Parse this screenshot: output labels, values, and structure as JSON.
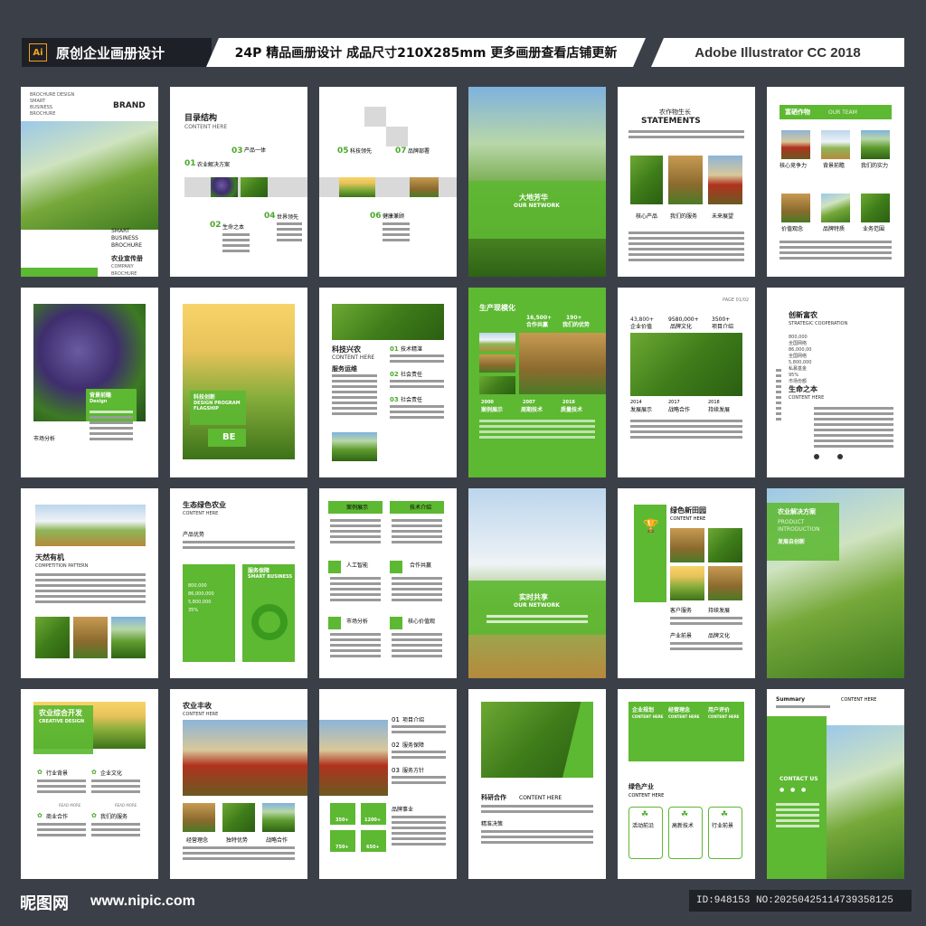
{
  "header": {
    "badge": "Ai",
    "left_title": "原创企业画册设计",
    "center_title": "24P 精品画册设计  成品尺寸210X285mm  更多画册查看店铺更新",
    "right_title": "Adobe Illustrator CC 2018"
  },
  "pages": {
    "p1": {
      "brand": "BRAND",
      "tiny1": "BROCHURE DESIGN",
      "tiny2": "SMART",
      "tiny3": "BUSINESS",
      "tiny4": "BROCHURE",
      "smart": "SMART",
      "business": "BUSINESS",
      "brochure": "BROCHURE",
      "title": "农业宣传册",
      "sub": "COMPANY BROCHURE"
    },
    "p2": {
      "title": "目录结构",
      "sub": "CONTENT HERE",
      "n1": "01",
      "l1": "农业解决方案",
      "n2": "03",
      "l2": "产品一体",
      "n3": "02",
      "l3": "生命之本",
      "n4": "04",
      "l4": "世界领先"
    },
    "p3": {
      "n1": "05",
      "l1": "科技领先",
      "n2": "07",
      "l2": "品牌部署",
      "n3": "06",
      "l3": "健康兼顾"
    },
    "p4": {
      "title": "大地芳华",
      "sub": "OUR NETWORK"
    },
    "p5": {
      "title": "农作物生长",
      "sub": "STATEMENTS",
      "c1": "核心产品",
      "c2": "我们的服务",
      "c3": "未来展望"
    },
    "p6": {
      "title": "富硒作物",
      "sub": "OUR TEAM",
      "c1": "核心竞争力",
      "c2": "背景前瞻",
      "c3": "我们的实力",
      "c4": "价值观念",
      "c5": "品牌特质",
      "c6": "业务范围"
    },
    "p7": {
      "title": "背景前瞻",
      "sub": "Design",
      "label": "市场分析"
    },
    "p8": {
      "title": "科技创新",
      "sub": "DESIGN PROGRAM",
      "sub2": "FLAGSHIP",
      "be": "BE"
    },
    "p9": {
      "title": "科技兴农",
      "sub": "CONTENT HERE",
      "s2": "服务运维",
      "n1": "01",
      "l1": "技术精湛",
      "n2": "02",
      "l2": "社会责任",
      "n3": "03",
      "l3": "社会责任"
    },
    "p10": {
      "title": "生产现模化",
      "v1": "16,500+",
      "l1": "合作共赢",
      "v2": "190+",
      "l2": "我们的优势",
      "y1": "2000",
      "y2": "2007",
      "y3": "2018",
      "c1": "案例展示",
      "c2": "周期技术",
      "c3": "质量技术"
    },
    "p11": {
      "page": "PAGE 01/02",
      "v1": "43,800+",
      "l1": "企业价值",
      "v2": "9580,000+",
      "l2": "品牌文化",
      "v3": "3500+",
      "l3": "项目介绍",
      "y1": "2014",
      "y2": "2017",
      "y3": "2018",
      "c1": "发展展示",
      "c2": "战略合作",
      "c3": "持续发展"
    },
    "p12": {
      "title": "创新富农",
      "sub": "STRATEGIC COOPERATION",
      "v1": "800,000",
      "l1": "全国网络",
      "v2": "86,000,00",
      "l2": "全国网络",
      "v3": "5,800,000",
      "l3": "私募基金",
      "v4": "95%",
      "l4": "市场份额",
      "t2": "生命之本",
      "sub2": "CONTENT HERE"
    },
    "p13": {
      "title": "天然有机",
      "sub": "COMPETITION PATTERN"
    },
    "p14": {
      "title": "生态绿色农业",
      "sub": "CONTENT HERE",
      "s2": "产品优势",
      "v1": "800,000",
      "v2": "86,000,000",
      "v3": "5,800,000",
      "v4": "35%",
      "box": "服务保障",
      "boxsub": "SMART BUSINESS"
    },
    "p15": {
      "c1": "案例展示",
      "c2": "技术介绍",
      "c3": "人工智能",
      "c4": "合作共赢",
      "c5": "市场分析",
      "c6": "核心价值观"
    },
    "p16": {
      "title": "实时共享",
      "sub": "OUR NETWORK"
    },
    "p17": {
      "title": "绿色新田园",
      "sub": "CONTENT HERE",
      "c1": "客户服务",
      "c2": "持续发展",
      "c3": "产业前景",
      "c4": "品牌文化"
    },
    "p18": {
      "title": "农业解决方案",
      "sub1": "PRODUCT",
      "sub2": "INTRODUCTION",
      "s3": "发展自创新"
    },
    "p19": {
      "title": "农业综合开发",
      "sub": "CREATIVE DESIGN",
      "c1": "行业背景",
      "c2": "企业文化",
      "c3": "商业合作",
      "c4": "我们的服务",
      "btn": "READ MORE"
    },
    "p20": {
      "title": "农业丰收",
      "sub": "CONTENT HERE",
      "c1": "经营理念",
      "c2": "独特优势",
      "c3": "战略合作"
    },
    "p21": {
      "n1": "01",
      "l1": "项目介绍",
      "n2": "02",
      "l2": "服务保障",
      "n3": "03",
      "l3": "服务方针",
      "s": "品牌事业",
      "v1": "350+",
      "v2": "1200+",
      "v3": "750+",
      "v4": "650+"
    },
    "p22": {
      "title": "科研合作",
      "sub": "CONTENT HERE",
      "s2": "精准决策"
    },
    "p23": {
      "c1": "企业规划",
      "c2": "经营理念",
      "c3": "用户评价",
      "s": "CONTENT HERE",
      "title": "绿色产业",
      "sub": "CONTENT HERE",
      "d1": "活动前沿",
      "d2": "高新技术",
      "d3": "行业前景"
    },
    "p24": {
      "sum": "Summary",
      "sub": "CONTENT HERE",
      "contact": "CONTACT US"
    }
  },
  "footer": {
    "logo": "昵图网",
    "url": "www.nipic.com",
    "id_text": "ID:948153 NO:20250425114739358125"
  },
  "colors": {
    "green": "#5db832",
    "bg": "#3b4048",
    "dark": "#1d2026"
  }
}
